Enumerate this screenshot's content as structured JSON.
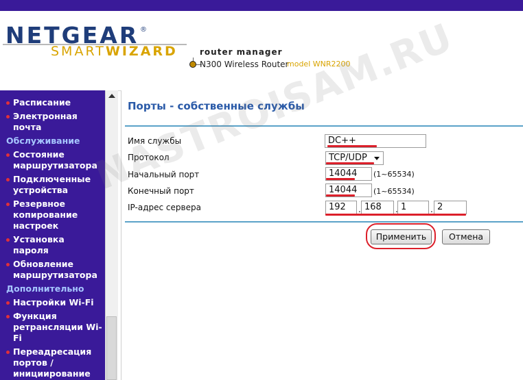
{
  "header": {
    "brand": "NETGEAR",
    "brand_mark": "®",
    "sub_brand_plain": "SMART",
    "sub_brand_bold": "WIZARD",
    "product_title": "router manager",
    "device_name": "N300 Wireless Router",
    "model": "model WNR2200"
  },
  "sidebar": {
    "items": [
      {
        "type": "link",
        "label": "Расписание"
      },
      {
        "type": "link",
        "label": "Электронная почта"
      },
      {
        "type": "section",
        "label": "Обслуживание"
      },
      {
        "type": "link",
        "label": "Состояние маршрутизатора"
      },
      {
        "type": "link",
        "label": "Подключенные устройства"
      },
      {
        "type": "link",
        "label": "Резервное копирование настроек"
      },
      {
        "type": "link",
        "label": "Установка пароля"
      },
      {
        "type": "link",
        "label": "Обновление маршрутизатора"
      },
      {
        "type": "section",
        "label": "Дополнительно"
      },
      {
        "type": "link",
        "label": "Настройки Wi-Fi"
      },
      {
        "type": "link",
        "label": "Функция ретрансляции Wi-Fi"
      },
      {
        "type": "link",
        "label": "Переадресация портов / инициирование портов"
      }
    ]
  },
  "page": {
    "title": "Порты - собственные службы",
    "service_name_label": "Имя службы",
    "service_name_value": "DC++",
    "protocol_label": "Протокол",
    "protocol_value": "TCP/UDP",
    "start_port_label": "Начальный порт",
    "start_port_value": "14044",
    "start_port_range": "(1~65534)",
    "end_port_label": "Конечный порт",
    "end_port_value": "14044",
    "end_port_range": "(1~65534)",
    "server_ip_label": "IP-адрес сервера",
    "ip_octets": [
      "192",
      "168",
      "1",
      "2"
    ],
    "ip_separator": ".",
    "apply_label": "Применить",
    "cancel_label": "Отмена"
  },
  "watermark": "NASTROISAM.RU",
  "colors": {
    "nav_bg": "#3a1a99",
    "title": "#2a5aa8",
    "annotation": "#dc1f2a",
    "brand_gold": "#d9a400"
  }
}
